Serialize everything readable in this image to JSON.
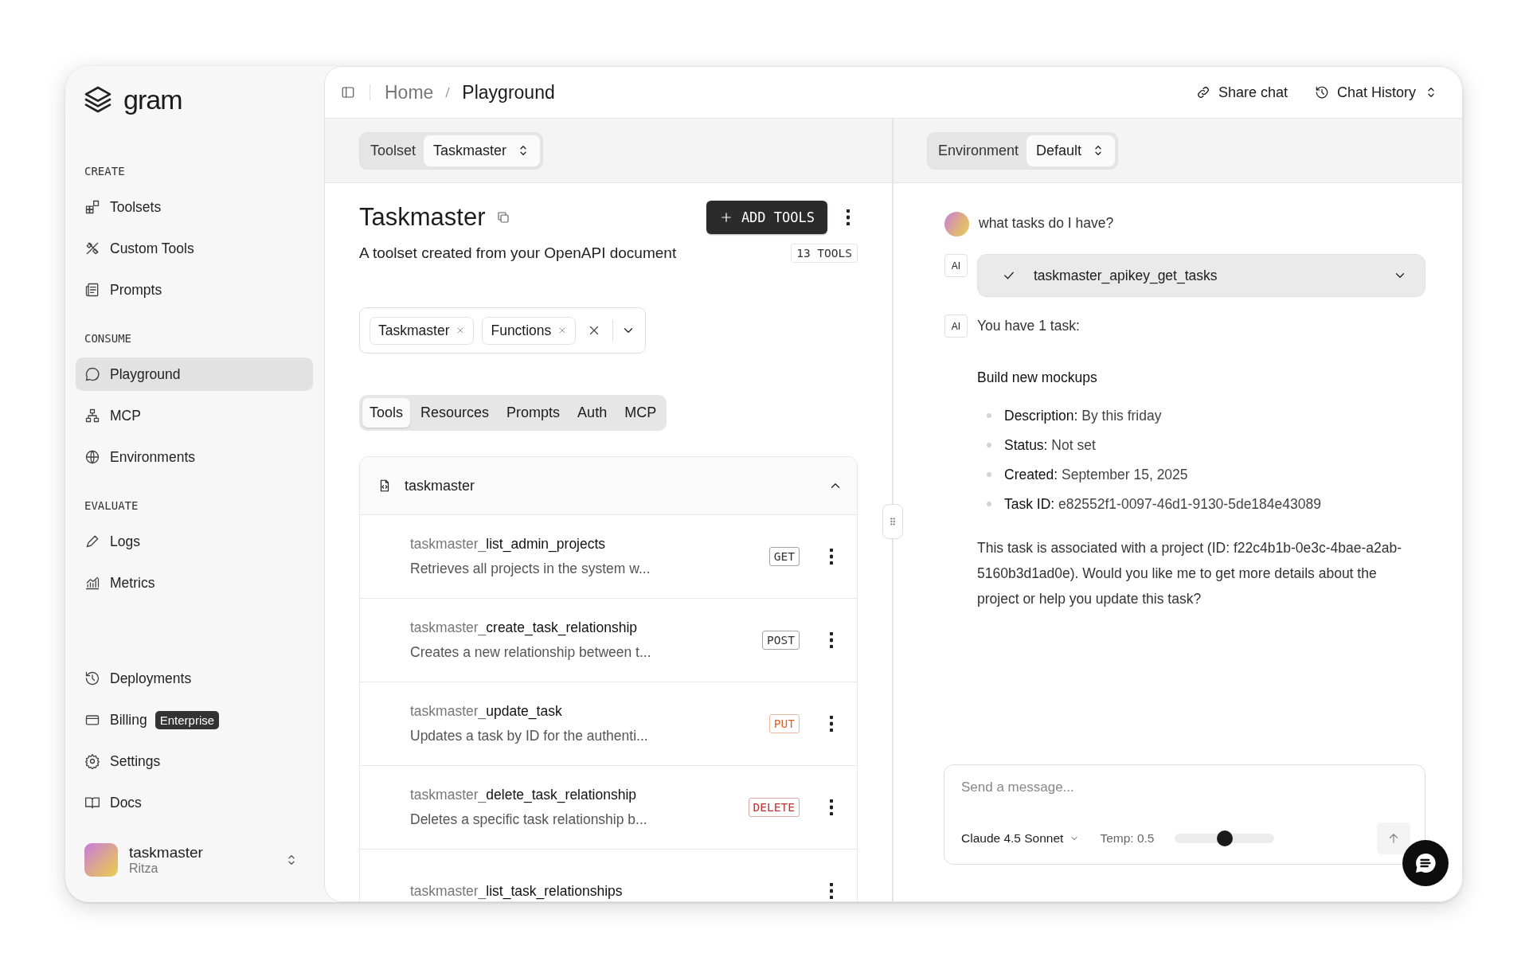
{
  "sidebar": {
    "brand": "gram",
    "sections": [
      {
        "heading": "CREATE",
        "items": [
          {
            "label": "Toolsets",
            "selected": false
          },
          {
            "label": "Custom Tools",
            "selected": false
          },
          {
            "label": "Prompts",
            "selected": false
          }
        ]
      },
      {
        "heading": "CONSUME",
        "items": [
          {
            "label": "Playground",
            "selected": true
          },
          {
            "label": "MCP",
            "selected": false
          },
          {
            "label": "Environments",
            "selected": false
          }
        ]
      },
      {
        "heading": "EVALUATE",
        "items": [
          {
            "label": "Logs",
            "selected": false
          },
          {
            "label": "Metrics",
            "selected": false
          }
        ]
      },
      {
        "items": [
          {
            "label": "Deployments",
            "selected": false
          },
          {
            "label": "Billing",
            "badge": "Enterprise",
            "selected": false
          },
          {
            "label": "Settings",
            "selected": false
          },
          {
            "label": "Docs",
            "selected": false
          }
        ]
      }
    ],
    "account": {
      "name": "taskmaster",
      "org": "Ritza"
    }
  },
  "header": {
    "breadcrumb": [
      "Home",
      "Playground"
    ],
    "actions": [
      "Share chat",
      "Chat History"
    ]
  },
  "toolset_picker": {
    "label": "Toolset",
    "value": "Taskmaster"
  },
  "environment_picker": {
    "label": "Environment",
    "value": "Default"
  },
  "toolset": {
    "title": "Taskmaster",
    "add_button": "ADD TOOLS",
    "description": "A toolset created from your OpenAPI document",
    "count": "13 TOOLS",
    "filters": [
      "Taskmaster",
      "Functions"
    ],
    "tabs": [
      {
        "label": "Tools",
        "selected": true
      },
      {
        "label": "Resources",
        "selected": false
      },
      {
        "label": "Prompts",
        "selected": false
      },
      {
        "label": "Auth",
        "selected": false
      },
      {
        "label": "MCP",
        "selected": false
      }
    ],
    "group": {
      "name": "taskmaster",
      "expanded": true,
      "tools": [
        {
          "name": "taskmaster_**list_admin_projects**",
          "description": "Retrieves all projects in the system w...",
          "method": "GET",
          "color": "#333333"
        },
        {
          "name": "taskmaster_**create_task_relationship**",
          "description": "Creates a new relationship between t...",
          "method": "POST",
          "color": "#333333"
        },
        {
          "name": "taskmaster_**update_task**",
          "description": "Updates a task by ID for the authenti...",
          "method": "PUT",
          "color": "#d9622b"
        },
        {
          "name": "taskmaster_**delete_task_relationship**",
          "description": "Deletes a specific task relationship b...",
          "method": "DELETE",
          "color": "#c53030"
        },
        {
          "name": "taskmaster_**list_task_relationships**"
        }
      ]
    }
  },
  "chat": {
    "messages": [
      {
        "kind": "user",
        "text": "what tasks do I have?"
      },
      {
        "kind": "tool_call",
        "label": "AI",
        "tool": "taskmaster_apikey_get_tasks",
        "done": true,
        "expanded": false
      },
      {
        "kind": "assistant",
        "label": "AI",
        "intro": "You have 1 task:",
        "heading": "Build new mockups",
        "bullets": [
          "**Description:** By this friday",
          "**Status:** Not set",
          "**Created:** September 15, 2025",
          "**Task ID:** e82552f1-0097-46d1-9130-5de184e43089"
        ],
        "paragraph": "This task is associated with a project (ID: f22c4b1b-0e3c-4bae-a2ab-5160b3d1ad0e). Would you like me to get more details about the project or help you update this task?"
      }
    ],
    "composer": {
      "placeholder": "Send a message...",
      "model": "Claude 4.5 Sonnet",
      "temperature": "Temp: 0.5",
      "level": 0.5
    }
  }
}
